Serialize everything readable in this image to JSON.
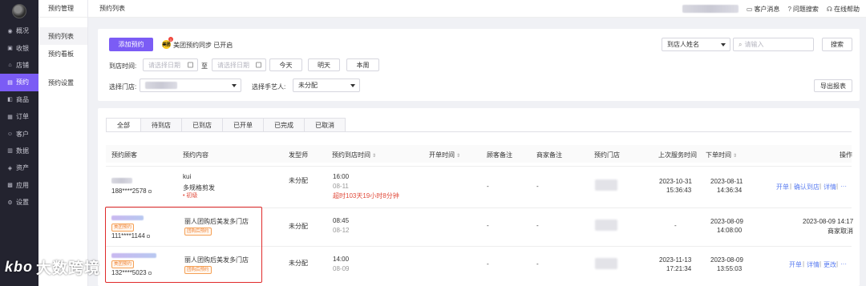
{
  "nav": {
    "items": [
      {
        "label": "概况",
        "icon": "dashboard-icon",
        "glyph": "◉"
      },
      {
        "label": "收银",
        "icon": "cashier-icon",
        "glyph": "▣"
      },
      {
        "label": "店铺",
        "icon": "store-icon",
        "glyph": "⌂"
      },
      {
        "label": "预约",
        "icon": "calendar-icon",
        "glyph": "▤",
        "active": true
      },
      {
        "label": "商品",
        "icon": "goods-icon",
        "glyph": "◧"
      },
      {
        "label": "订单",
        "icon": "order-icon",
        "glyph": "▦"
      },
      {
        "label": "客户",
        "icon": "customer-icon",
        "glyph": "☺"
      },
      {
        "label": "数据",
        "icon": "data-icon",
        "glyph": "▥"
      },
      {
        "label": "资产",
        "icon": "asset-icon",
        "glyph": "◈"
      },
      {
        "label": "应用",
        "icon": "apps-icon",
        "glyph": "▩"
      },
      {
        "label": "设置",
        "icon": "settings-icon",
        "glyph": "⚙"
      }
    ]
  },
  "submenu": {
    "title": "预约管理",
    "items": [
      "预约列表",
      "预约看板",
      "预约设置"
    ]
  },
  "topbar": {
    "breadcrumb": "预约列表",
    "messages": "客户消息",
    "search_issue": "问题搜索",
    "help": "在线帮助"
  },
  "filter": {
    "add_button": "添加预约",
    "meituan_badge": "美团",
    "notice_count": "1",
    "sync_status": "美团预约同步 已开启",
    "search_type": "到店人姓名",
    "search_placeholder": "请输入",
    "search_button": "搜索",
    "arrive_time_label": "到店时间:",
    "start_date_placeholder": "请选择日期",
    "to_label": "至",
    "end_date_placeholder": "请选择日期",
    "today": "今天",
    "tomorrow": "明天",
    "this_week": "本周",
    "store_label": "选择门店:",
    "artist_label": "选择手艺人:",
    "artist_value": "未分配",
    "export_button": "导出报表"
  },
  "tabs": [
    "全部",
    "待到店",
    "已到店",
    "已开单",
    "已完成",
    "已取消"
  ],
  "table": {
    "headers": {
      "customer": "预约顾客",
      "content": "预约内容",
      "stylist": "发型师",
      "arrive_time": "预约到店时间",
      "open_time": "开单时间",
      "customer_note": "顾客备注",
      "merchant_note": "商家备注",
      "store": "预约门店",
      "last_service": "上次服务时间",
      "order_time": "下单时间",
      "actions": "操作"
    },
    "rows": [
      {
        "phone": "188****2578",
        "service": "kui",
        "service2": "多规格剪发",
        "level": "• 初级",
        "stylist": "未分配",
        "time": "16:00",
        "date": "08-11",
        "overdue": "超时103天19小时8分钟",
        "open_time": "-",
        "customer_note": "-",
        "merchant_note": "-",
        "last_date": "2023-10-31",
        "last_time": "15:36:43",
        "order_date": "2023-08-11",
        "order_time": "14:36:34",
        "actions": [
          "开单",
          "确认到店",
          "详情",
          "···"
        ]
      },
      {
        "tag": "美团预约",
        "phone": "111****1144",
        "service": "丽人团购后美发多门店",
        "service_tag": "团购后预约",
        "stylist": "未分配",
        "time": "08:45",
        "date": "08-12",
        "open_time": "-",
        "customer_note": "-",
        "merchant_note": "-",
        "last_service": "-",
        "order_date": "2023-08-09",
        "order_time": "14:08:00",
        "cancel_time": "2023-08-09 14:17",
        "cancel_status": "商家取消"
      },
      {
        "tag": "美团预约",
        "phone": "132****5023",
        "service": "丽人团购后美发多门店",
        "service_tag": "团购后预约",
        "stylist": "未分配",
        "time": "14:00",
        "date": "08-09",
        "open_time": "-",
        "customer_note": "-",
        "merchant_note": "-",
        "last_date": "2023-11-13",
        "last_time": "17:21:34",
        "order_date": "2023-08-09",
        "order_time": "13:55:03",
        "actions": [
          "开单",
          "详情",
          "更改",
          "···"
        ]
      }
    ]
  },
  "brand": {
    "text": "大数跨境",
    "logo": "kbo"
  }
}
